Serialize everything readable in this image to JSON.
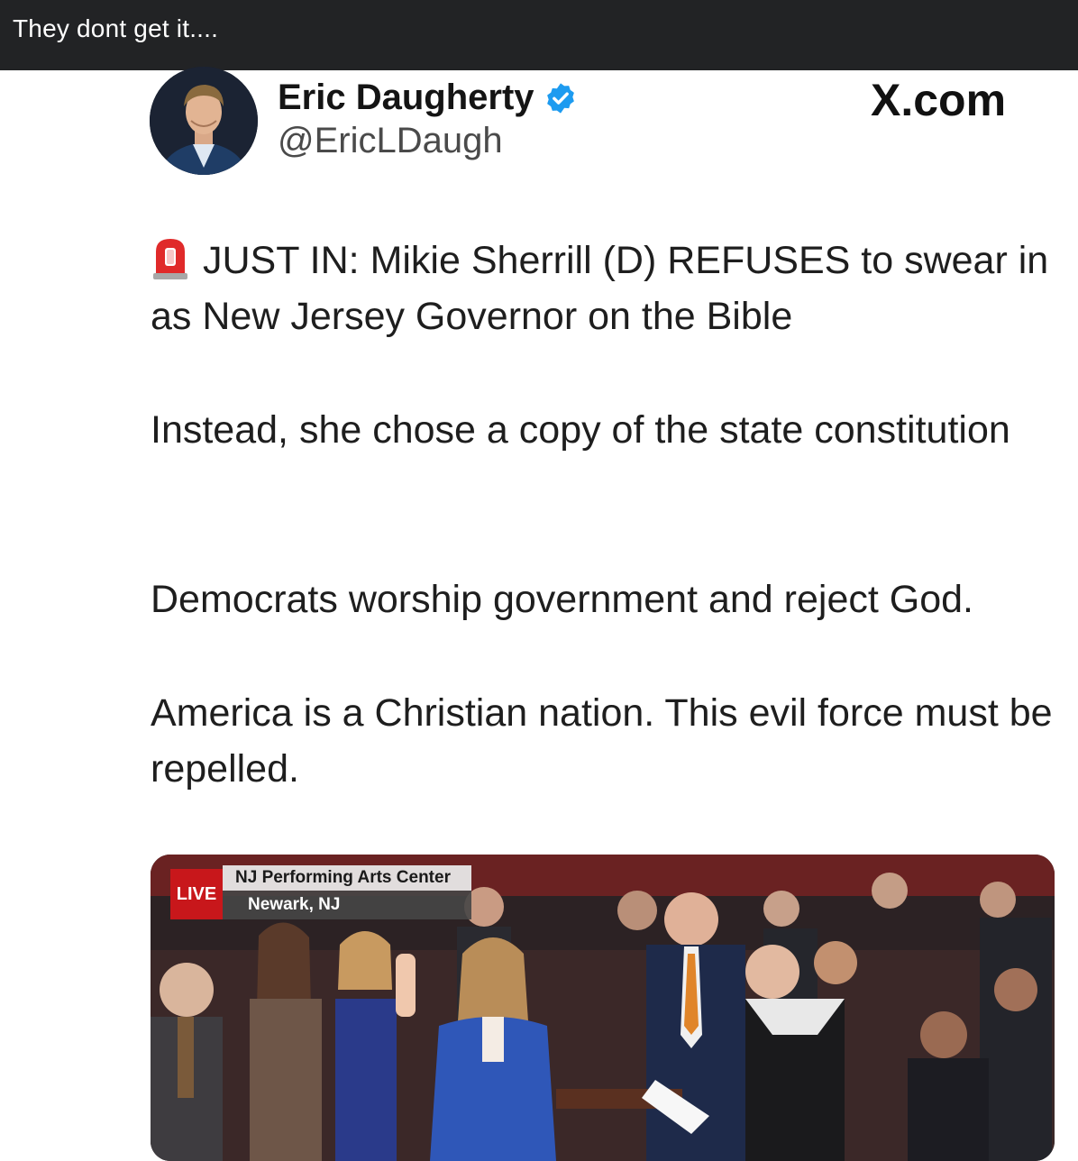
{
  "header": {
    "title": "They dont get it...."
  },
  "post": {
    "author_name": "Eric Daugherty",
    "handle": "@EricLDaugh",
    "verified_icon": "verified-badge-icon",
    "platform": "X.com",
    "paragraphs": [
      "JUST IN: Mikie Sherrill (D) REFUSES to swear in as New Jersey Governor on the Bible",
      "Instead, she chose a copy of the state constitution",
      "Democrats worship government and reject God.",
      "America is a Christian nation. This evil force must be repelled."
    ],
    "lead_icon": "police-siren-icon"
  },
  "media": {
    "live_label": "LIVE",
    "location_line1": "NJ Performing Arts Center",
    "location_line2": "Newark, NJ"
  },
  "colors": {
    "topbar": "#222325",
    "verified": "#1d9bf0",
    "live": "#c8171b"
  }
}
